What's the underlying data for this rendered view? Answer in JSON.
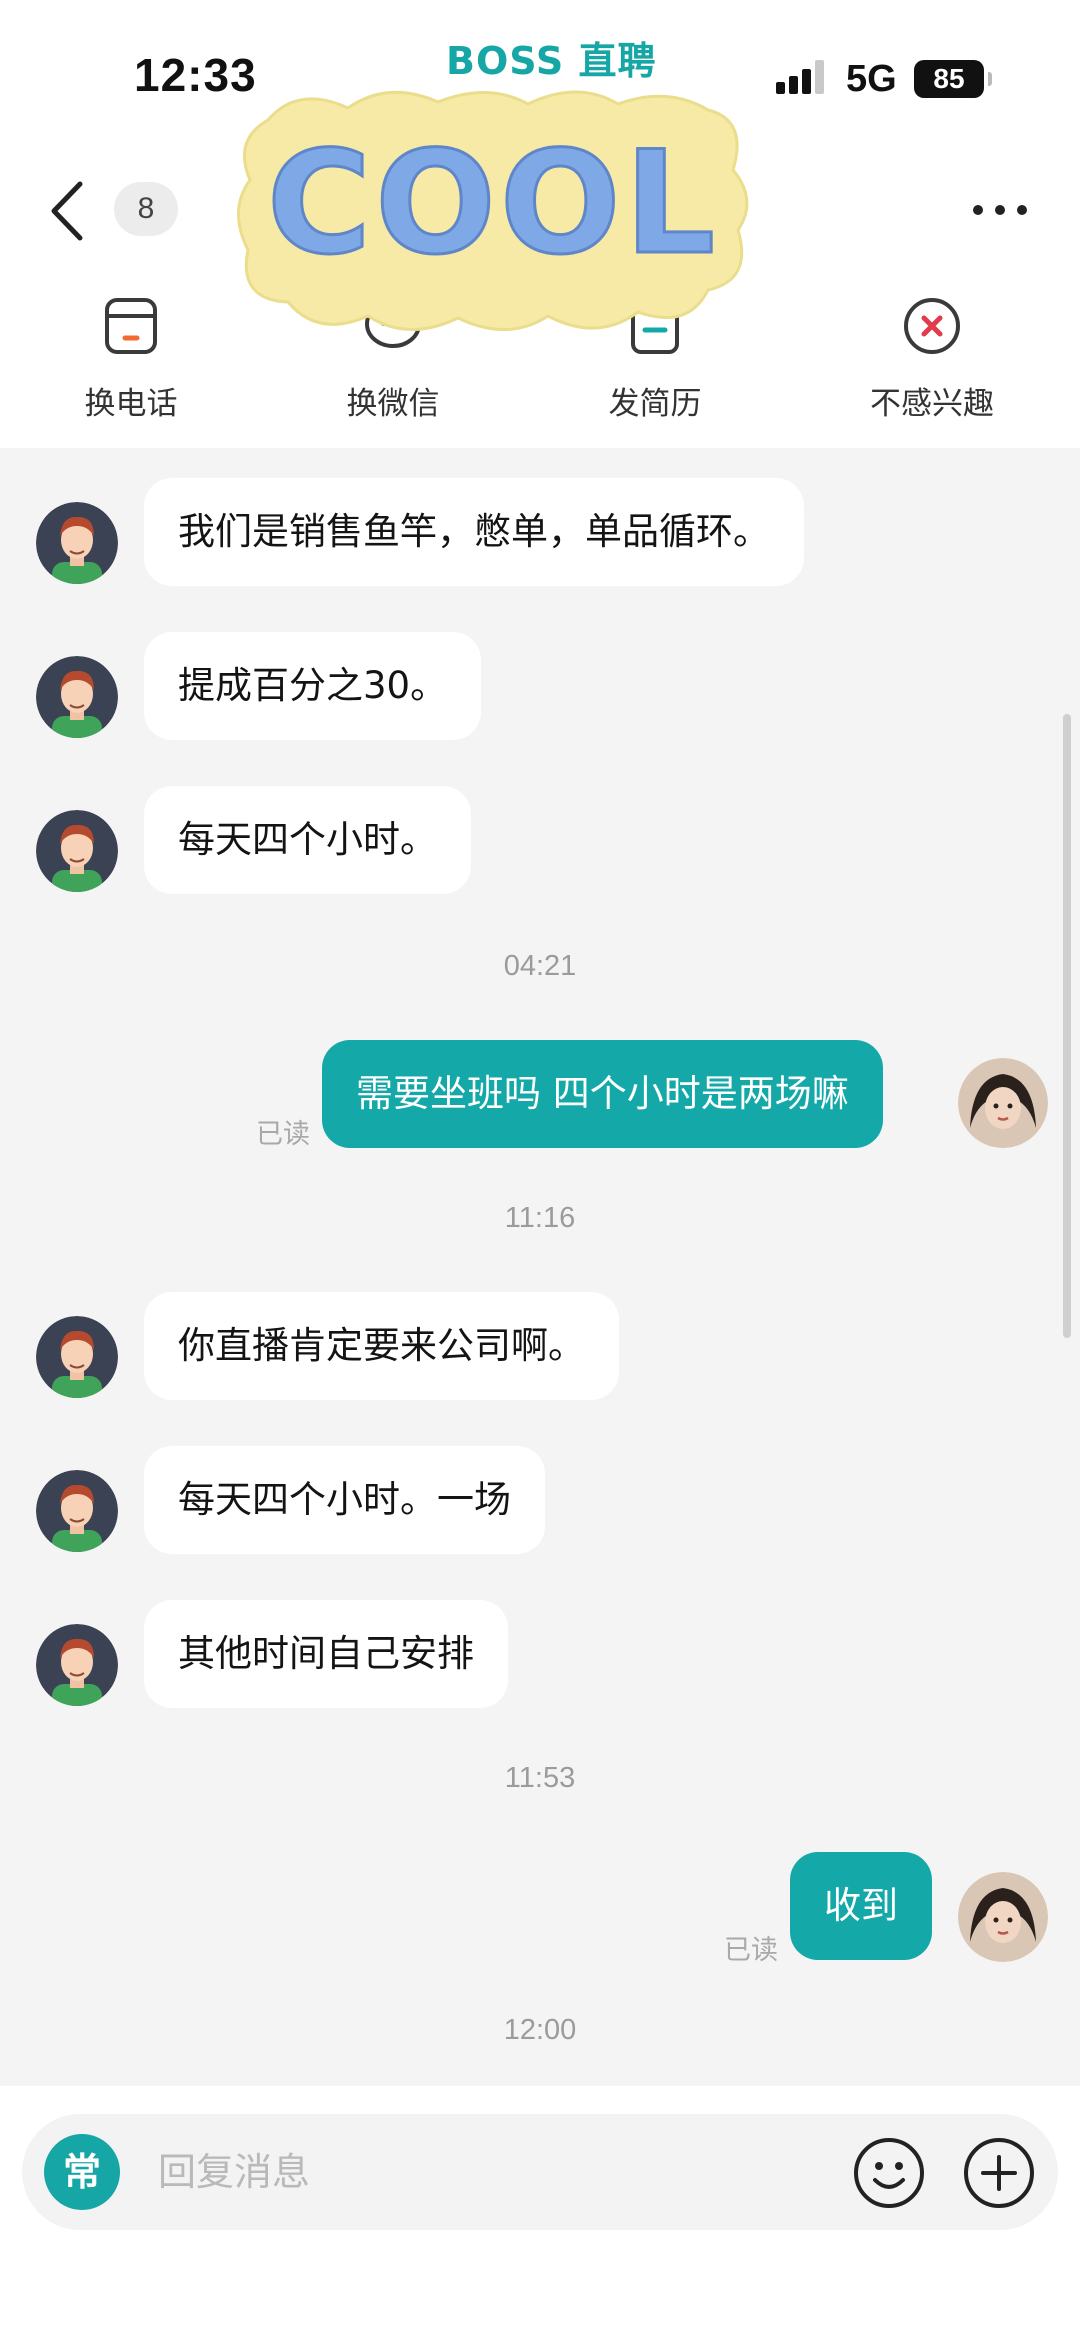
{
  "status_bar": {
    "time": "12:33",
    "app_name": "BOSS 直聘",
    "network": "5G",
    "battery": "85"
  },
  "header": {
    "unread_count": "8",
    "sticker_text": "COOL",
    "actions": [
      {
        "label": "换电话",
        "icon": "phone-card-icon"
      },
      {
        "label": "换微信",
        "icon": "wechat-icon"
      },
      {
        "label": "发简历",
        "icon": "resume-icon"
      },
      {
        "label": "不感兴趣",
        "icon": "not-interested-icon"
      }
    ]
  },
  "messages": [
    {
      "side": "left",
      "text": "我们是销售鱼竿，憋单，单品循环。"
    },
    {
      "side": "left",
      "text": "提成百分之30。"
    },
    {
      "side": "left",
      "text": "每天四个小时。"
    },
    {
      "type": "time",
      "text": "04:21"
    },
    {
      "side": "right",
      "text": "需要坐班吗 四个小时是两场嘛",
      "status": "已读"
    },
    {
      "type": "time",
      "text": "11:16"
    },
    {
      "side": "left",
      "text": "你直播肯定要来公司啊。"
    },
    {
      "side": "left",
      "text": "每天四个小时。一场"
    },
    {
      "side": "left",
      "text": "其他时间自己安排"
    },
    {
      "type": "time",
      "text": "11:53"
    },
    {
      "side": "right",
      "text": "收到",
      "status": "已读"
    },
    {
      "type": "time",
      "text": "12:00"
    }
  ],
  "composer": {
    "phrase_button": "常",
    "placeholder": "回复消息"
  },
  "colors": {
    "accent": "#15a8a8",
    "background": "#f4f4f4",
    "danger": "#e23b4b"
  }
}
